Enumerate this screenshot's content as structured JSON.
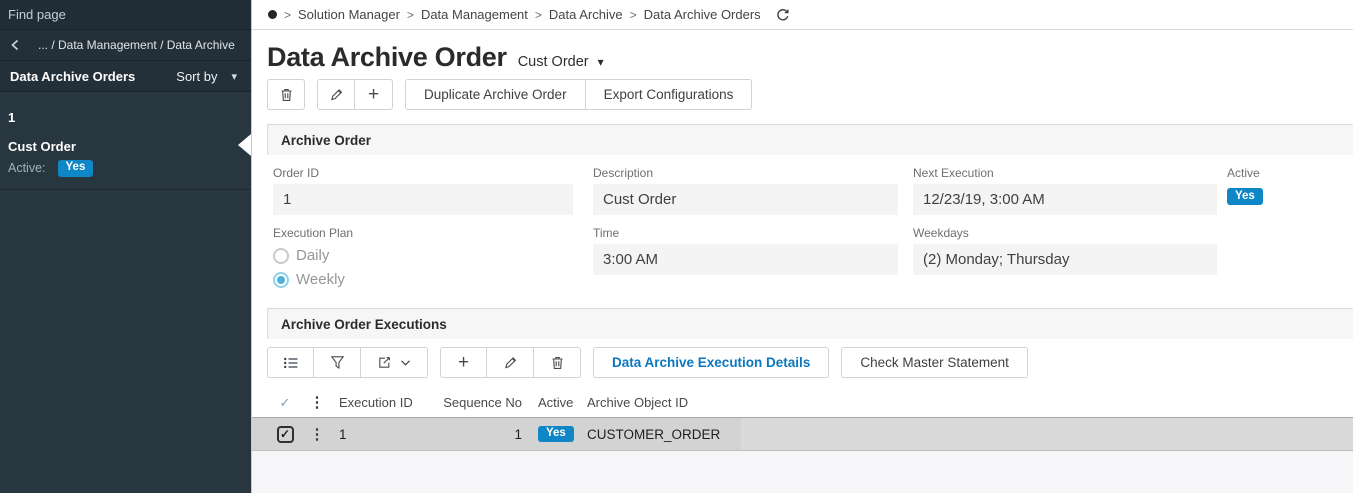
{
  "sidebar": {
    "find_page": "Find page",
    "breadcrumb": "... / Data Management / Data Archive",
    "list_title": "Data Archive Orders",
    "sort_by": "Sort by",
    "item": {
      "id": "1",
      "name": "Cust Order",
      "active_label": "Active:",
      "active_value": "Yes"
    }
  },
  "topbar": {
    "breadcrumb": [
      "Solution Manager",
      "Data Management",
      "Data Archive",
      "Data Archive Orders"
    ]
  },
  "header": {
    "title": "Data Archive Order",
    "subtitle": "Cust Order"
  },
  "toolbar": {
    "duplicate_label": "Duplicate Archive Order",
    "export_label": "Export Configurations"
  },
  "archive_order": {
    "section_title": "Archive Order",
    "order_id": {
      "label": "Order ID",
      "value": "1"
    },
    "description": {
      "label": "Description",
      "value": "Cust Order"
    },
    "next_execution": {
      "label": "Next Execution",
      "value": "12/23/19, 3:00 AM"
    },
    "active": {
      "label": "Active",
      "value": "Yes"
    },
    "execution_plan": {
      "label": "Execution Plan",
      "options": [
        {
          "label": "Daily",
          "selected": false
        },
        {
          "label": "Weekly",
          "selected": true
        }
      ]
    },
    "time": {
      "label": "Time",
      "value": "3:00 AM"
    },
    "weekdays": {
      "label": "Weekdays",
      "value": "(2) Monday; Thursday"
    }
  },
  "executions": {
    "section_title": "Archive Order Executions",
    "details_button": "Data Archive Execution Details",
    "check_button": "Check Master Statement",
    "table": {
      "columns": [
        "Execution ID",
        "Sequence No",
        "Active",
        "Archive Object ID"
      ],
      "rows": [
        {
          "execution_id": "1",
          "sequence_no": "1",
          "active": "Yes",
          "archive_object_id": "CUSTOMER_ORDER",
          "selected": true
        }
      ]
    }
  },
  "icons": {
    "breadcrumb_sep": ">",
    "caret_down": "▾",
    "plus": "+",
    "kebab": "⋮",
    "check": "✓"
  },
  "colors": {
    "accent_blue": "#0f86c5",
    "link_blue": "#0b77be",
    "sidebar_bg": "#28363f",
    "selected_row": "#d3d3d3",
    "radio_selected": "#4eb2d8"
  }
}
